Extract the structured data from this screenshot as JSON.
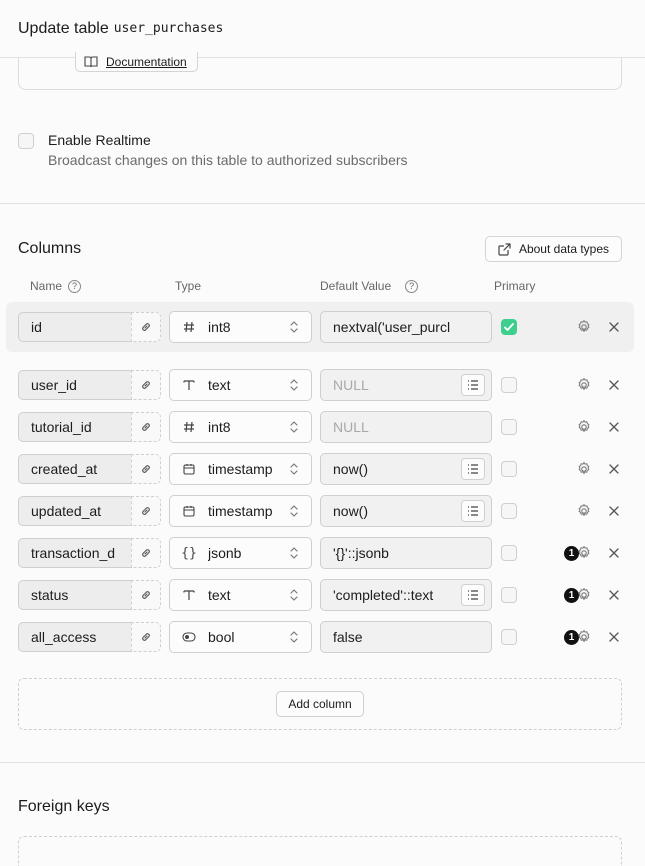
{
  "header": {
    "title": "Update table",
    "table_name": "user_purchases"
  },
  "prev_section": {
    "doc_button": "Documentation"
  },
  "realtime": {
    "label": "Enable Realtime",
    "description": "Broadcast changes on this table to authorized subscribers",
    "checked": false
  },
  "columns": {
    "title": "Columns",
    "about_button": "About data types",
    "headers": {
      "name": "Name",
      "type": "Type",
      "default": "Default Value",
      "primary": "Primary"
    },
    "rows": [
      {
        "name": "id",
        "type": "int8",
        "type_icon": "hash-icon",
        "default": "nextval('user_purcl",
        "default_is_placeholder": false,
        "has_list": false,
        "primary": true,
        "badge": ""
      },
      {
        "name": "user_id",
        "type": "text",
        "type_icon": "text-type-icon",
        "default": "NULL",
        "default_is_placeholder": true,
        "has_list": true,
        "primary": false,
        "badge": ""
      },
      {
        "name": "tutorial_id",
        "type": "int8",
        "type_icon": "hash-icon",
        "default": "NULL",
        "default_is_placeholder": true,
        "has_list": false,
        "primary": false,
        "badge": ""
      },
      {
        "name": "created_at",
        "type": "timestamp",
        "type_icon": "calendar-icon",
        "default": "now()",
        "default_is_placeholder": false,
        "has_list": true,
        "primary": false,
        "badge": ""
      },
      {
        "name": "updated_at",
        "type": "timestamp",
        "type_icon": "calendar-icon",
        "default": "now()",
        "default_is_placeholder": false,
        "has_list": true,
        "primary": false,
        "badge": ""
      },
      {
        "name": "transaction_d",
        "type": "jsonb",
        "type_icon": "braces-icon",
        "default": "'{}'::jsonb",
        "default_is_placeholder": false,
        "has_list": false,
        "primary": false,
        "badge": "1"
      },
      {
        "name": "status",
        "type": "text",
        "type_icon": "text-type-icon",
        "default": "'completed'::text",
        "default_is_placeholder": false,
        "has_list": true,
        "primary": false,
        "badge": "1"
      },
      {
        "name": "all_access",
        "type": "bool",
        "type_icon": "toggle-icon",
        "default": "false",
        "default_is_placeholder": false,
        "has_list": false,
        "primary": false,
        "badge": "1"
      }
    ],
    "add_button": "Add column"
  },
  "foreign_keys": {
    "title": "Foreign keys"
  },
  "colors": {
    "primary_check": "#3ecf8e",
    "badge": "#111111"
  }
}
